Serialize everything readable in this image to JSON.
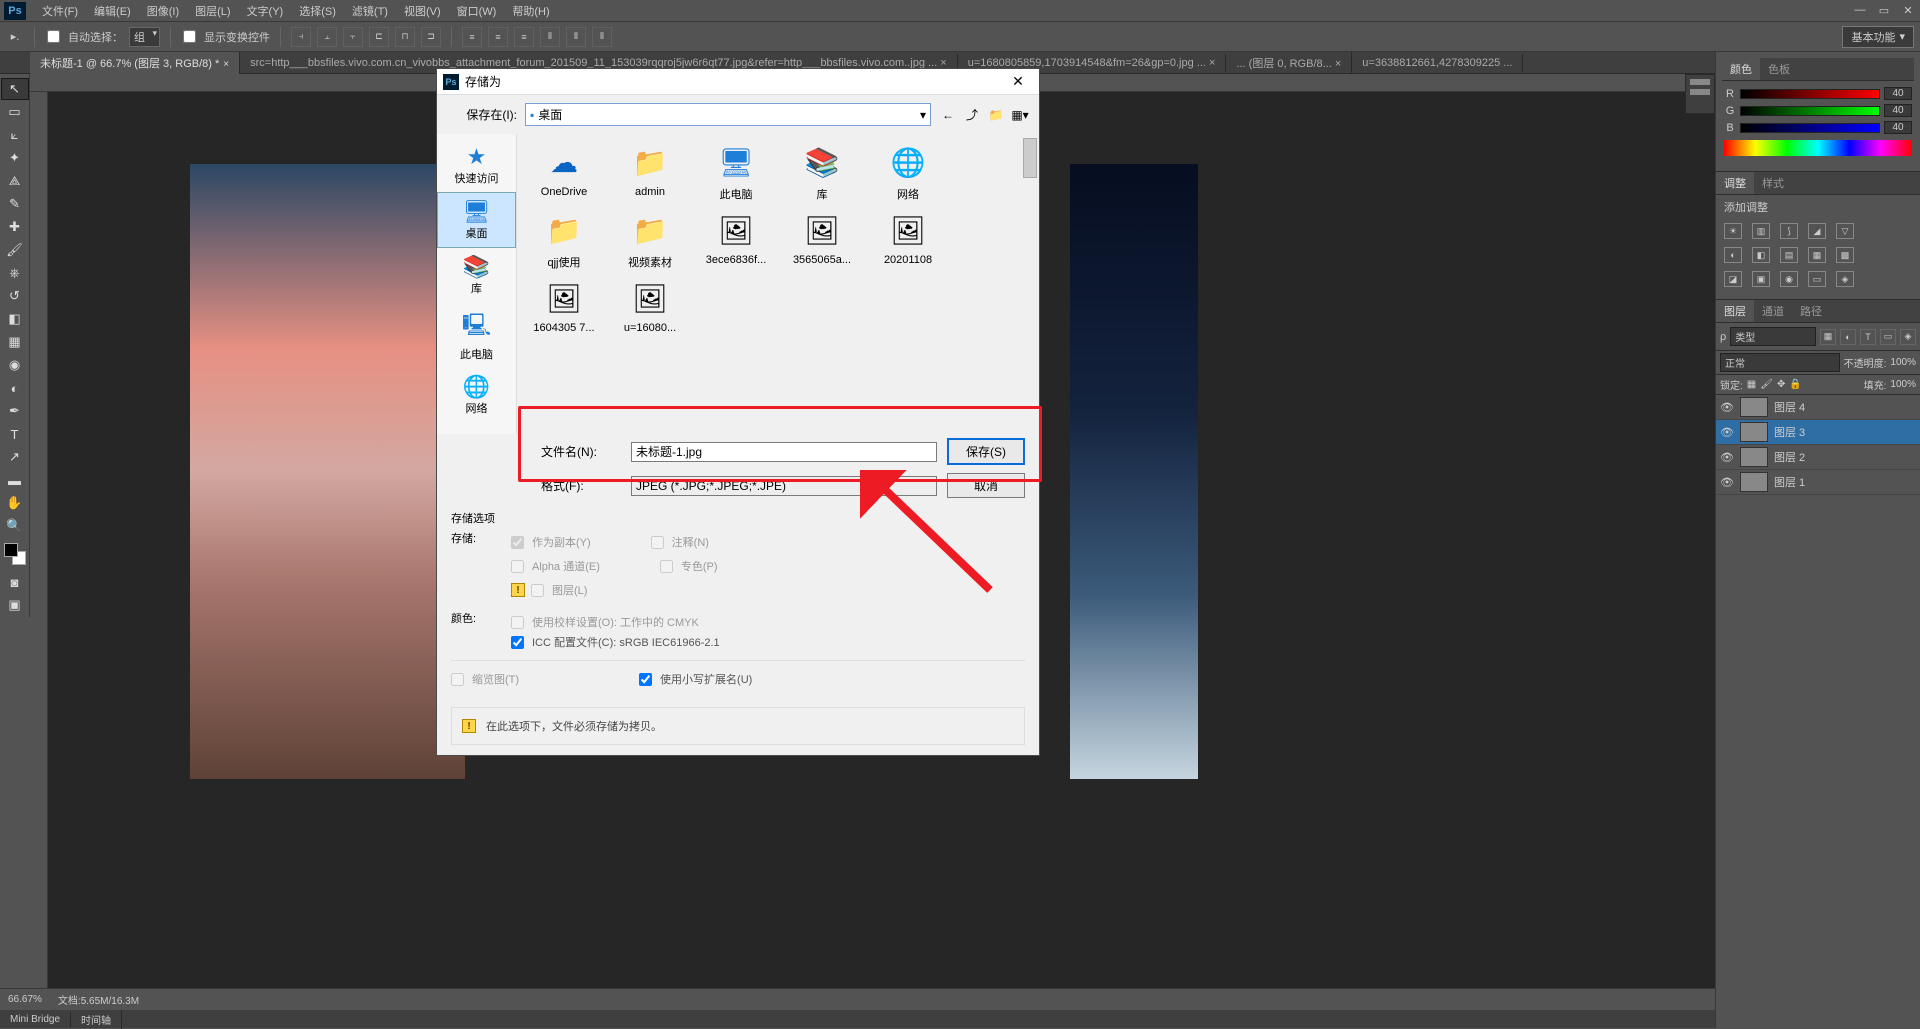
{
  "menubar": {
    "items": [
      "文件(F)",
      "编辑(E)",
      "图像(I)",
      "图层(L)",
      "文字(Y)",
      "选择(S)",
      "滤镜(T)",
      "视图(V)",
      "窗口(W)",
      "帮助(H)"
    ]
  },
  "optionsbar": {
    "autoSelectLabel": "自动选择：",
    "autoSelectValue": "组",
    "showTransformLabel": "显示变换控件",
    "basicLabel": "基本功能"
  },
  "tabs": [
    {
      "label": "未标题-1 @ 66.7% (图层 3, RGB/8) *",
      "active": true
    },
    {
      "label": "src=http___bbsfiles.vivo.com.cn_vivobbs_attachment_forum_201509_11_153039rqqroj5jw6r6qt77.jpg&refer=http___bbsfiles.vivo.com..jpg ... ×"
    },
    {
      "label": "u=1680805859,1703914548&fm=26&gp=0.jpg ... ×"
    },
    {
      "label": "... (图层 0, RGB/8... ×"
    },
    {
      "label": "u=3638812661,4278309225 ..."
    }
  ],
  "status": {
    "zoom": "66.67%",
    "doc": "文档:5.65M/16.3M"
  },
  "bottomTabs": [
    "Mini Bridge",
    "时间轴"
  ],
  "colorPanel": {
    "tabs": [
      "颜色",
      "色板"
    ],
    "r": "40",
    "g": "40",
    "b": "40"
  },
  "adjustPanel": {
    "tabs": [
      "调整",
      "样式"
    ],
    "title": "添加调整"
  },
  "layersPanel": {
    "tabs": [
      "图层",
      "通道",
      "路径"
    ],
    "kind": "类型",
    "blend": "正常",
    "opacityLabel": "不透明度:",
    "opacity": "100%",
    "lockLabel": "锁定:",
    "fillLabel": "填充:",
    "fill": "100%",
    "layers": [
      {
        "name": "图层 4",
        "sel": false
      },
      {
        "name": "图层 3",
        "sel": true
      },
      {
        "name": "图层 2",
        "sel": false
      },
      {
        "name": "图层 1",
        "sel": false
      }
    ]
  },
  "dialog": {
    "title": "存储为",
    "saveInLabel": "保存在(I):",
    "saveInValue": "桌面",
    "sideNav": [
      "快速访问",
      "桌面",
      "库",
      "此电脑",
      "网络"
    ],
    "files": [
      {
        "name": "OneDrive",
        "icon": "☁"
      },
      {
        "name": "admin",
        "icon": "👤"
      },
      {
        "name": "此电脑",
        "icon": "🖥"
      },
      {
        "name": "库",
        "icon": "📚"
      },
      {
        "name": "网络",
        "icon": "🌐"
      },
      {
        "name": "qjj使用",
        "icon": "📁"
      },
      {
        "name": "视频素材",
        "icon": "📁"
      },
      {
        "name": "3ece6836f...",
        "icon": "🖼"
      },
      {
        "name": "3565065a...",
        "icon": "🖼"
      },
      {
        "name": "20201108",
        "icon": "🖼"
      },
      {
        "name": "1604305 7...",
        "icon": "🖼"
      },
      {
        "name": "u=16080...",
        "icon": "🖼"
      }
    ],
    "filenameLabel": "文件名(N):",
    "filenameValue": "未标题-1.jpg",
    "formatLabel": "格式(F):",
    "formatValue": "JPEG (*.JPG;*.JPEG;*.JPE)",
    "saveBtn": "保存(S)",
    "cancelBtn": "取消",
    "optsHeader": "存储选项",
    "storeLabel": "存储:",
    "asCopy": "作为副本(Y)",
    "notes": "注释(N)",
    "alpha": "Alpha 通道(E)",
    "spot": "专色(P)",
    "layersOpt": "图层(L)",
    "colorLabel": "颜色:",
    "proof": "使用校样设置(O): 工作中的 CMYK",
    "icc": "ICC 配置文件(C): sRGB IEC61966-2.1",
    "thumbLabel": "缩览图(T)",
    "lcExt": "使用小写扩展名(U)",
    "warnMsg": "在此选项下，文件必须存储为拷贝。"
  }
}
